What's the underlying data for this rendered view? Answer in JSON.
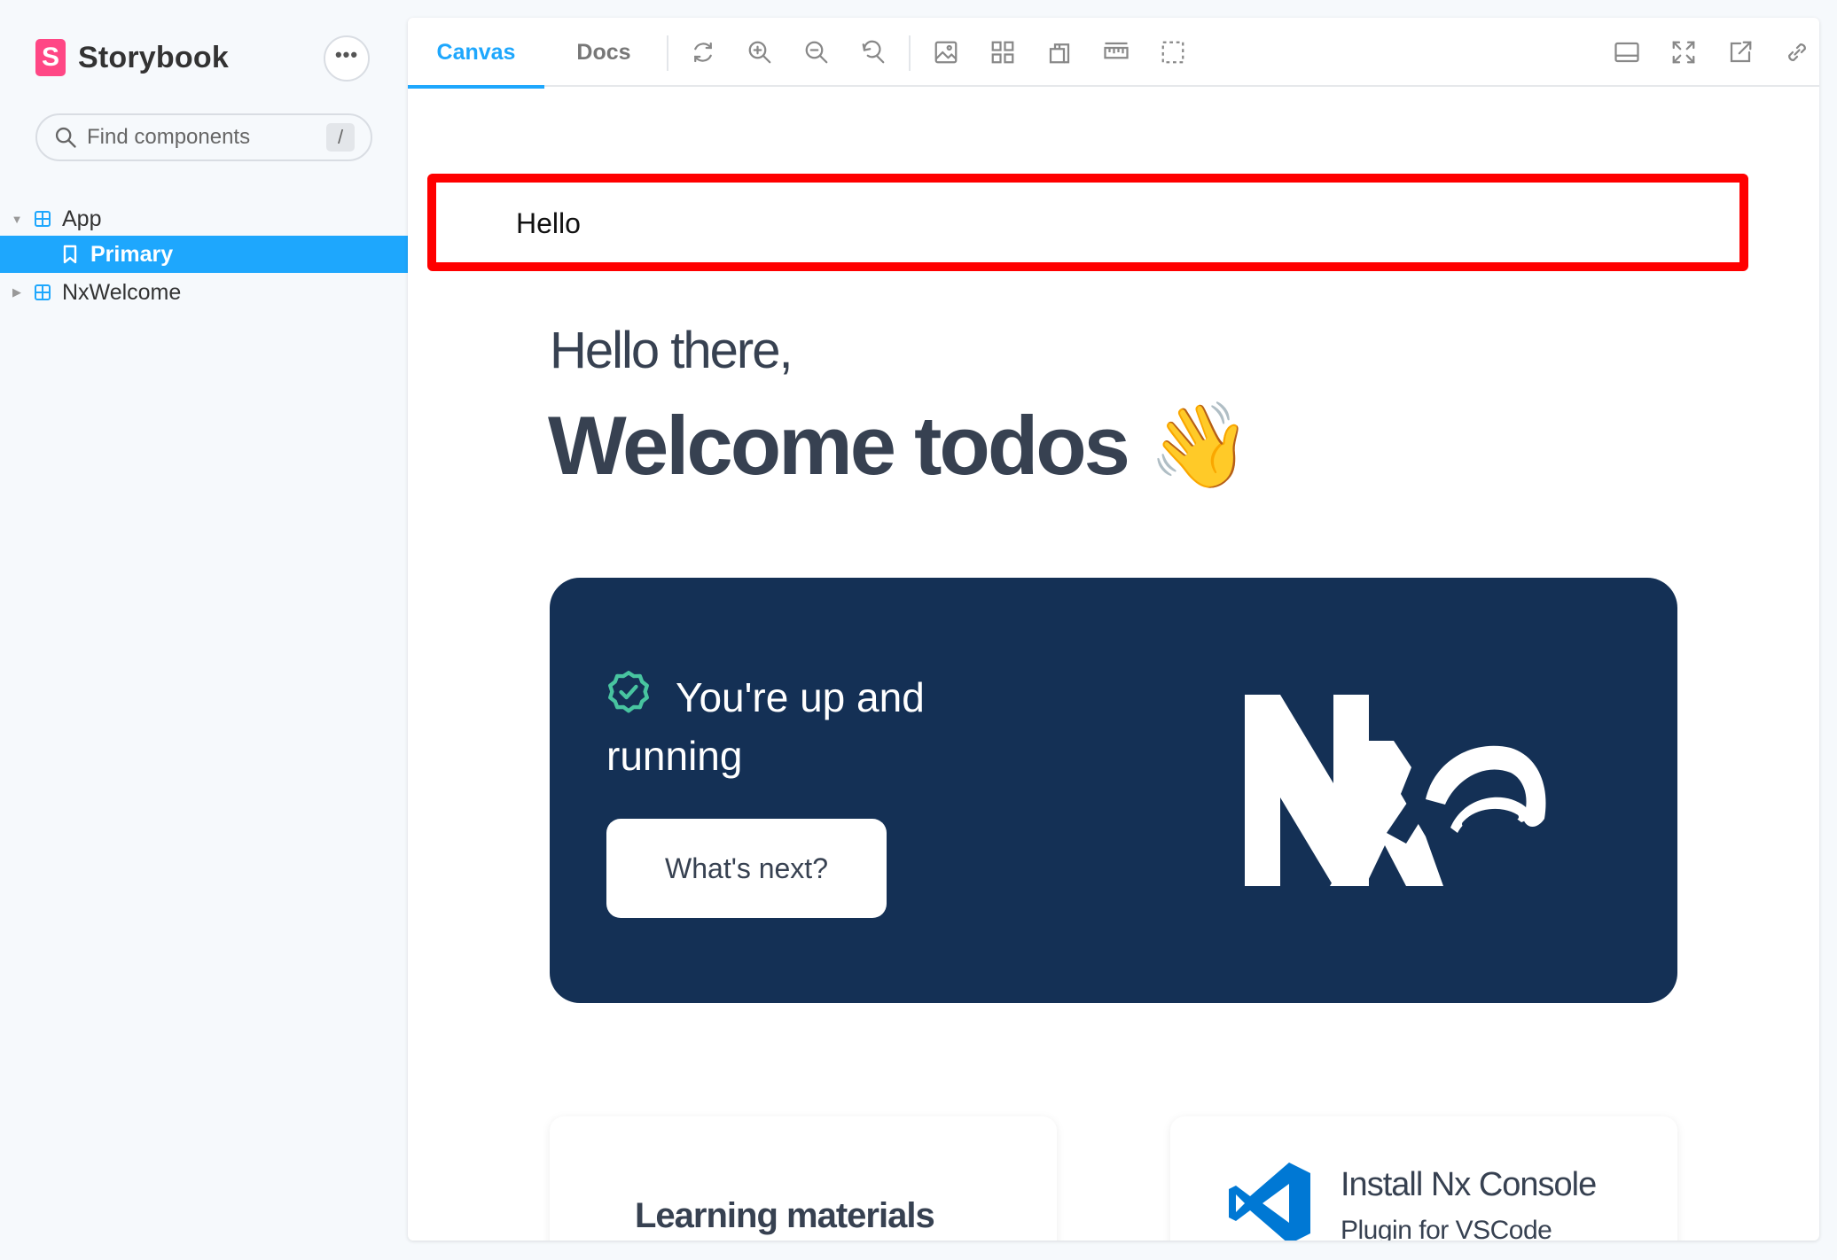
{
  "sidebar": {
    "brand": "Storybook",
    "brand_letter": "S",
    "menu_label": "•••",
    "search": {
      "placeholder": "Find components",
      "shortcut": "/"
    },
    "tree": [
      {
        "label": "App",
        "type": "component",
        "expanded": true
      },
      {
        "label": "Primary",
        "type": "story",
        "selected": true
      },
      {
        "label": "NxWelcome",
        "type": "component",
        "expanded": false
      }
    ]
  },
  "toolbar": {
    "tabs": [
      {
        "label": "Canvas",
        "active": true
      },
      {
        "label": "Docs",
        "active": false
      }
    ],
    "tools": [
      "reload-icon",
      "zoom-in-icon",
      "zoom-out-icon",
      "reset-zoom-icon",
      "background-icon",
      "grid-icon",
      "viewport-icon",
      "measure-icon",
      "outline-icon"
    ],
    "right_tools": [
      "panel-toggle-icon",
      "fullscreen-icon",
      "open-new-tab-icon",
      "copy-link-icon"
    ]
  },
  "preview": {
    "hello_text": "Hello",
    "greeting": "Hello there,",
    "welcome": "Welcome todos 👋",
    "hero": {
      "status_text": "You're up and running",
      "button_label": "What's next?"
    },
    "cards": [
      {
        "title": "Learning materials"
      },
      {
        "title": "Install Nx Console",
        "subtitle": "Plugin for VSCode"
      }
    ]
  },
  "colors": {
    "accent": "#1ea7fd",
    "storybook_pink": "#ff4785",
    "hero_bg": "#143055",
    "highlight_border": "#ff0000",
    "check_green": "#48c4a0",
    "vscode_blue": "#0078d4"
  }
}
